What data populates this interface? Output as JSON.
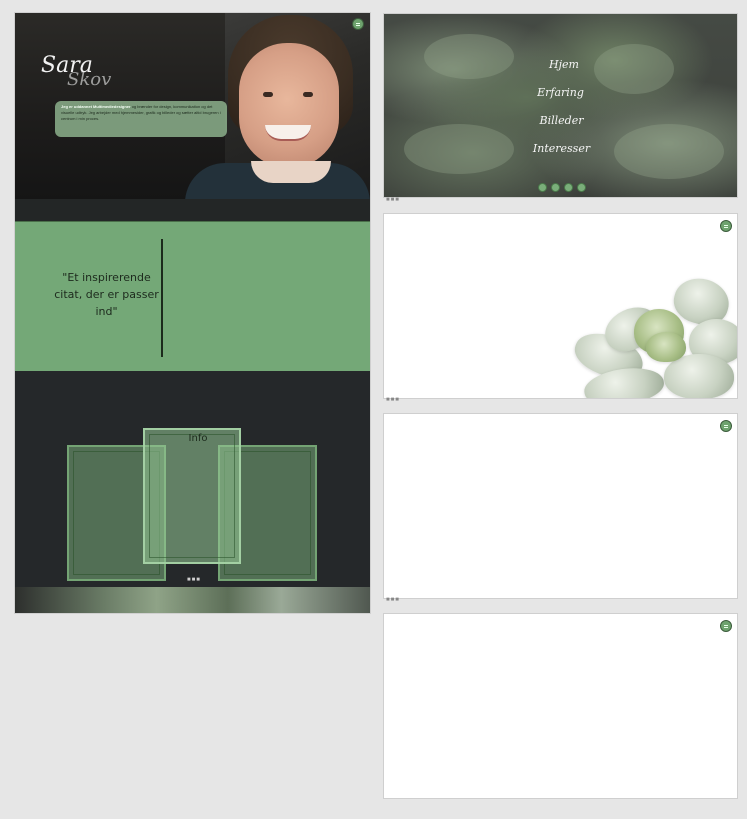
{
  "hero": {
    "logo_main": "Sara",
    "logo_sub": "Skov",
    "card_bold": "Jeg er uddannet Multimediedesigner",
    "card_text": "og brænder for design, kommunikation og det visuelle udtryk. Jeg arbejder med hjemmesider, grafik og billeder og sætter altid brugeren i centrum i min proces."
  },
  "quote": {
    "text": "\"Et inspirerende citat, der er passer ind\""
  },
  "info": {
    "label": "Info",
    "dots": "■■■"
  },
  "nav": {
    "items": [
      "Hjem",
      "Erfaring",
      "Billeder",
      "Interesser"
    ],
    "social": [
      "instagram-icon",
      "linkedin-icon",
      "facebook-icon",
      "mail-icon"
    ]
  },
  "frames": {
    "dots": "■■■"
  },
  "colors": {
    "accent_green": "#74a877",
    "dark_bg": "#25282a",
    "canvas": "#e6e6e6"
  }
}
